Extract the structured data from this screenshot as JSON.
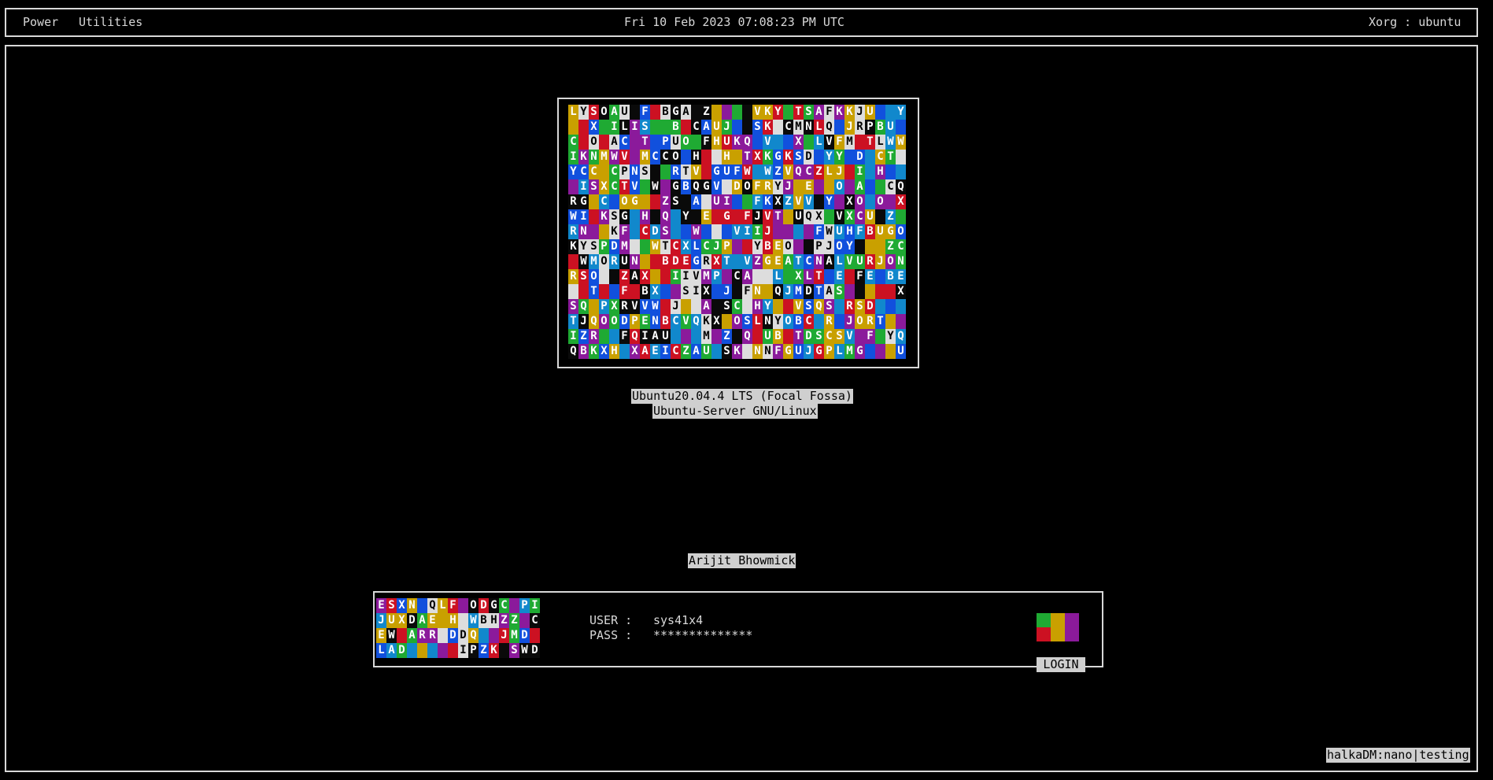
{
  "topbar": {
    "menu": [
      "Power",
      "Utilities"
    ],
    "datetime": "Fri 10 Feb 2023 07:08:23 PM UTC",
    "session": "Xorg : ubuntu"
  },
  "os_info": {
    "line1": "Ubuntu20.04.4 LTS (Focal Fossa)",
    "line2": "Ubuntu-Server GNU/Linux"
  },
  "display_name": "Arijit Bhowmick",
  "login": {
    "user_label": "USER :",
    "user_value": "sys41x4",
    "pass_label": "PASS :",
    "pass_value": "**************",
    "button_label": "LOGIN"
  },
  "footer": {
    "badge": "halkaDM:nano|testing"
  },
  "colors": {
    "palette": [
      "#cc1122",
      "#1faa33",
      "#c9a000",
      "#1150dd",
      "#8b1a9b",
      "#0a0a0a",
      "#dddddd",
      "#1188cc"
    ],
    "swatches": [
      "#1faa33",
      "#c9a000",
      "#8b1a9b",
      "#cc1122",
      "#c9a000",
      "#8b1a9b"
    ]
  },
  "icons": {
    "big_matrix": "random-character-matrix-logo",
    "small_matrix": "random-character-matrix-avatar"
  }
}
